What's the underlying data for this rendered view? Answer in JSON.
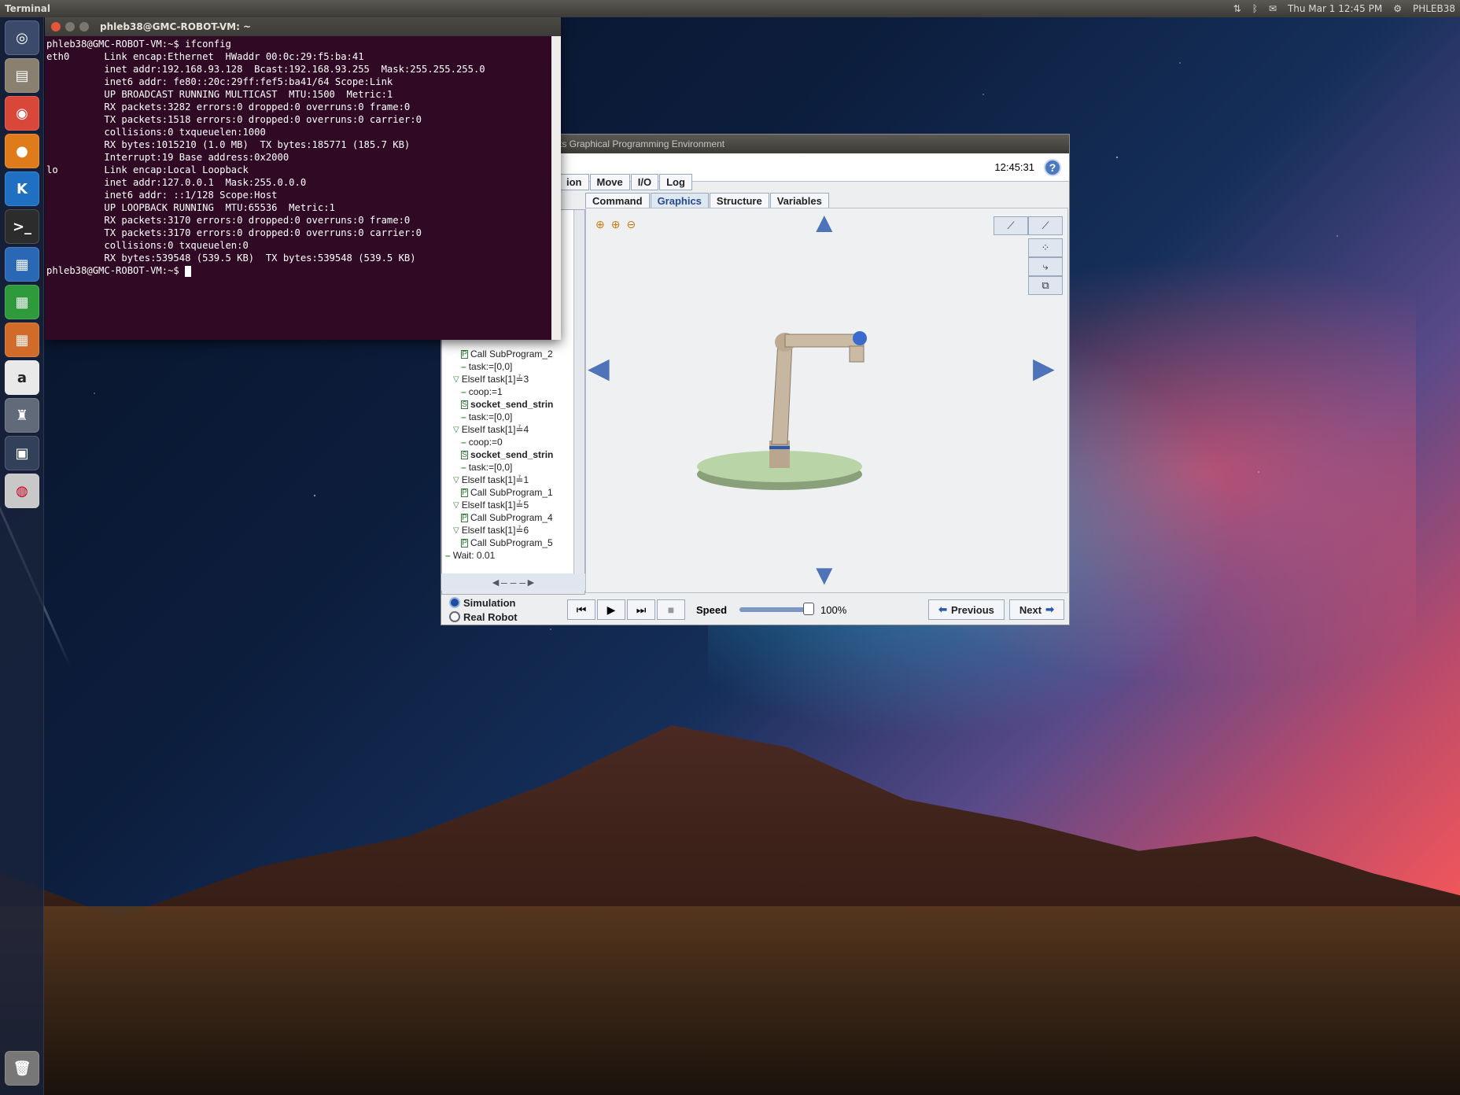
{
  "topbar": {
    "app_name": "Terminal",
    "datetime": "Thu Mar  1 12:45 PM",
    "user": "PHLEB38"
  },
  "launcher": {
    "items": [
      "ubuntu-dash",
      "files",
      "chrome",
      "firefox",
      "kde",
      "terminal",
      "writer",
      "calc",
      "impress",
      "amazon",
      "robot-app",
      "workspace",
      "dvd-burner",
      "trash"
    ]
  },
  "terminal": {
    "title": "phleb38@GMC-ROBOT-VM: ~",
    "lines": [
      "phleb38@GMC-ROBOT-VM:~$ ifconfig",
      "eth0      Link encap:Ethernet  HWaddr 00:0c:29:f5:ba:41",
      "          inet addr:192.168.93.128  Bcast:192.168.93.255  Mask:255.255.255.0",
      "          inet6 addr: fe80::20c:29ff:fef5:ba41/64 Scope:Link",
      "          UP BROADCAST RUNNING MULTICAST  MTU:1500  Metric:1",
      "          RX packets:3282 errors:0 dropped:0 overruns:0 frame:0",
      "          TX packets:1518 errors:0 dropped:0 overruns:0 carrier:0",
      "          collisions:0 txqueuelen:1000",
      "          RX bytes:1015210 (1.0 MB)  TX bytes:185771 (185.7 KB)",
      "          Interrupt:19 Base address:0x2000",
      "",
      "lo        Link encap:Local Loopback",
      "          inet addr:127.0.0.1  Mask:255.0.0.0",
      "          inet6 addr: ::1/128 Scope:Host",
      "          UP LOOPBACK RUNNING  MTU:65536  Metric:1",
      "          RX packets:3170 errors:0 dropped:0 overruns:0 frame:0",
      "          TX packets:3170 errors:0 dropped:0 overruns:0 carrier:0",
      "          collisions:0 txqueuelen:0",
      "          RX bytes:539548 (539.5 KB)  TX bytes:539548 (539.5 KB)",
      "",
      "phleb38@GMC-ROBOT-VM:~$ "
    ]
  },
  "ur": {
    "window_title": "ts Graphical Programming Environment",
    "clock": "12:45:31",
    "tabs_top": [
      "ion",
      "Move",
      "I/O",
      "Log"
    ],
    "tabs_sub": [
      "Command",
      "Graphics",
      "Structure",
      "Variables"
    ],
    "active_sub": "Graphics",
    "tree": [
      {
        "indent": 2,
        "kind": "p",
        "text": "Call SubProgram_2"
      },
      {
        "indent": 2,
        "kind": "dash",
        "text": "task:=[0,0]"
      },
      {
        "indent": 1,
        "kind": "tri",
        "text": "ElseIf task[1]≟3"
      },
      {
        "indent": 2,
        "kind": "dash",
        "text": "coop:=1"
      },
      {
        "indent": 2,
        "kind": "s",
        "text": "socket_send_strin",
        "bold": true
      },
      {
        "indent": 2,
        "kind": "dash",
        "text": "task:=[0,0]"
      },
      {
        "indent": 1,
        "kind": "tri",
        "text": "ElseIf task[1]≟4"
      },
      {
        "indent": 2,
        "kind": "dash",
        "text": "coop:=0"
      },
      {
        "indent": 2,
        "kind": "s",
        "text": "socket_send_strin",
        "bold": true
      },
      {
        "indent": 2,
        "kind": "dash",
        "text": "task:=[0,0]"
      },
      {
        "indent": 1,
        "kind": "tri",
        "text": "ElseIf task[1]≟1"
      },
      {
        "indent": 2,
        "kind": "p",
        "text": "Call SubProgram_1"
      },
      {
        "indent": 1,
        "kind": "tri",
        "text": "ElseIf task[1]≟5"
      },
      {
        "indent": 2,
        "kind": "p",
        "text": "Call SubProgram_4"
      },
      {
        "indent": 1,
        "kind": "tri",
        "text": "ElseIf task[1]≟6"
      },
      {
        "indent": 2,
        "kind": "p",
        "text": "Call SubProgram_5"
      },
      {
        "indent": 0,
        "kind": "dash",
        "text": "Wait: 0.01"
      }
    ],
    "simulation_label": "Simulation",
    "real_robot_label": "Real Robot",
    "mode": "Simulation",
    "speed_label": "Speed",
    "speed_value": "100%",
    "speed_fraction": 1.0,
    "prev_label": "Previous",
    "next_label": "Next"
  }
}
